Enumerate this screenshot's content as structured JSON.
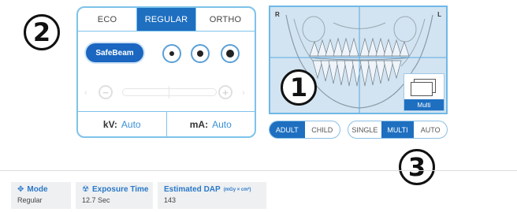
{
  "callouts": {
    "one": "1",
    "two": "2",
    "three": "3"
  },
  "exposure_panel": {
    "tabs": [
      {
        "label": "ECO",
        "active": false
      },
      {
        "label": "REGULAR",
        "active": true
      },
      {
        "label": "ORTHO",
        "active": false
      }
    ],
    "safebeam_label": "SafeBeam",
    "dose_buttons": [
      "radiation-low-icon",
      "radiation-medium-icon",
      "radiation-high-icon"
    ],
    "slider": {
      "minus": "−",
      "plus": "+",
      "prev": "‹",
      "next": "›"
    },
    "kv": {
      "label": "kV:",
      "value": "Auto"
    },
    "ma": {
      "label": "mA:",
      "value": "Auto"
    }
  },
  "xray_preview": {
    "left_side": "R",
    "right_side": "L",
    "thumbnail_label": "Multi"
  },
  "patient_size": {
    "options": [
      "ADULT",
      "CHILD"
    ],
    "selected": "ADULT"
  },
  "image_mode": {
    "options": [
      "SINGLE",
      "MULTI",
      "AUTO"
    ],
    "selected": "MULTI"
  },
  "status": {
    "mode": {
      "label": "Mode",
      "value": "Regular",
      "icon": "move-icon"
    },
    "exposure_time": {
      "label": "Exposure Time",
      "value": "12.7 Sec",
      "icon": "radiation-icon"
    },
    "dap": {
      "label": "Estimated DAP",
      "unit": "(mGy × cm²)",
      "value": "143"
    }
  },
  "colors": {
    "accent": "#1e6fc0",
    "border": "#7ec3ea",
    "value_text": "#3a8fd6",
    "status_bg": "#eef0f2"
  }
}
